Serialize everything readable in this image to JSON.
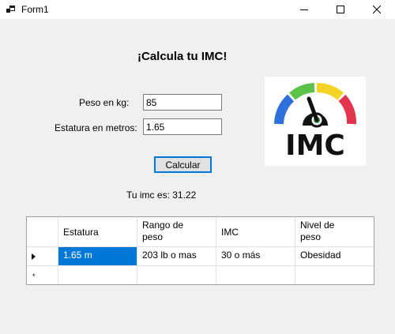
{
  "window": {
    "title": "Form1"
  },
  "heading": "¡Calcula tu IMC!",
  "form": {
    "weight_label": "Peso en kg:",
    "weight_value": "85",
    "height_label": "Estatura en metros:",
    "height_value": "1.65",
    "calculate_label": "Calcular",
    "result_text": "Tu imc es: 31.22"
  },
  "logo": {
    "text": "IMC",
    "gauge_colors": [
      "#2f6fdb",
      "#5cc24a",
      "#f5d324",
      "#e5344d"
    ]
  },
  "table": {
    "columns": [
      "Estatura",
      "Rango de\npeso",
      "IMC",
      "Nivel de\npeso"
    ],
    "rows": [
      [
        "1.65 m",
        "203 lb o mas",
        "30 o más",
        "Obesidad"
      ]
    ],
    "new_row_marker": "*"
  }
}
